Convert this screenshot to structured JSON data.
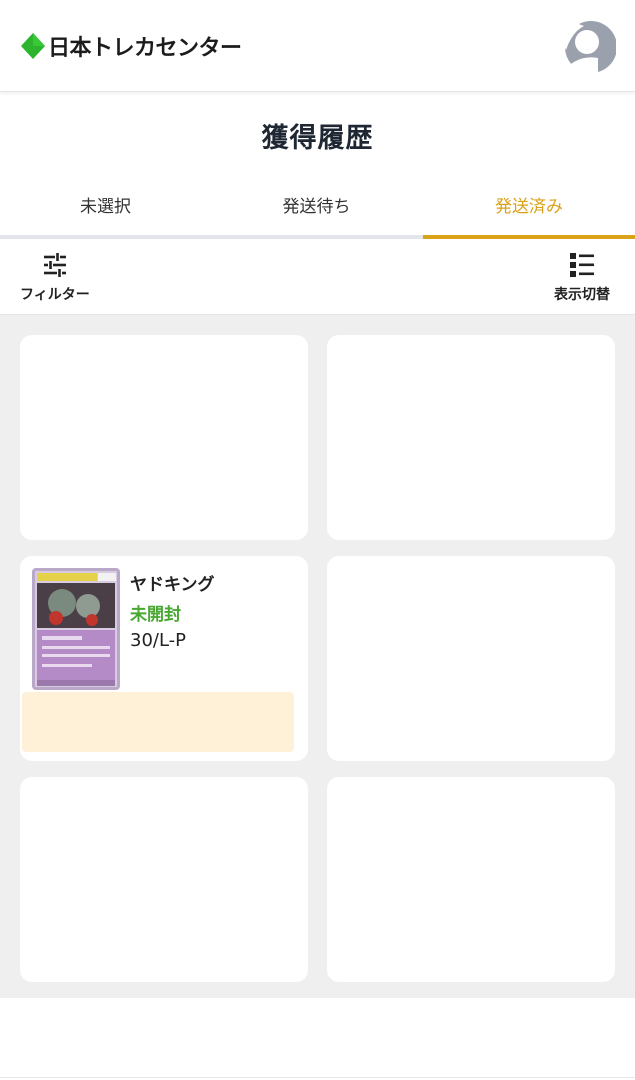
{
  "header": {
    "brand": "日本トレカセンター",
    "brand_color": "#2cb52c",
    "avatar_icon": "user-avatar-icon"
  },
  "page": {
    "title": "獲得履歴"
  },
  "tabs": [
    {
      "label": "未選択",
      "active": false
    },
    {
      "label": "発送待ち",
      "active": false
    },
    {
      "label": "発送済み",
      "active": true
    }
  ],
  "accent_color": "#d9a219",
  "toolbar": {
    "filter_label": "フィルター",
    "filter_icon": "sliders-icon",
    "view_toggle_label": "表示切替",
    "view_toggle_icon": "list-icon"
  },
  "items": [
    {
      "name": "ヤドキング",
      "status": "未開封",
      "status_color": "#48a832",
      "code": "30/L-P"
    }
  ]
}
